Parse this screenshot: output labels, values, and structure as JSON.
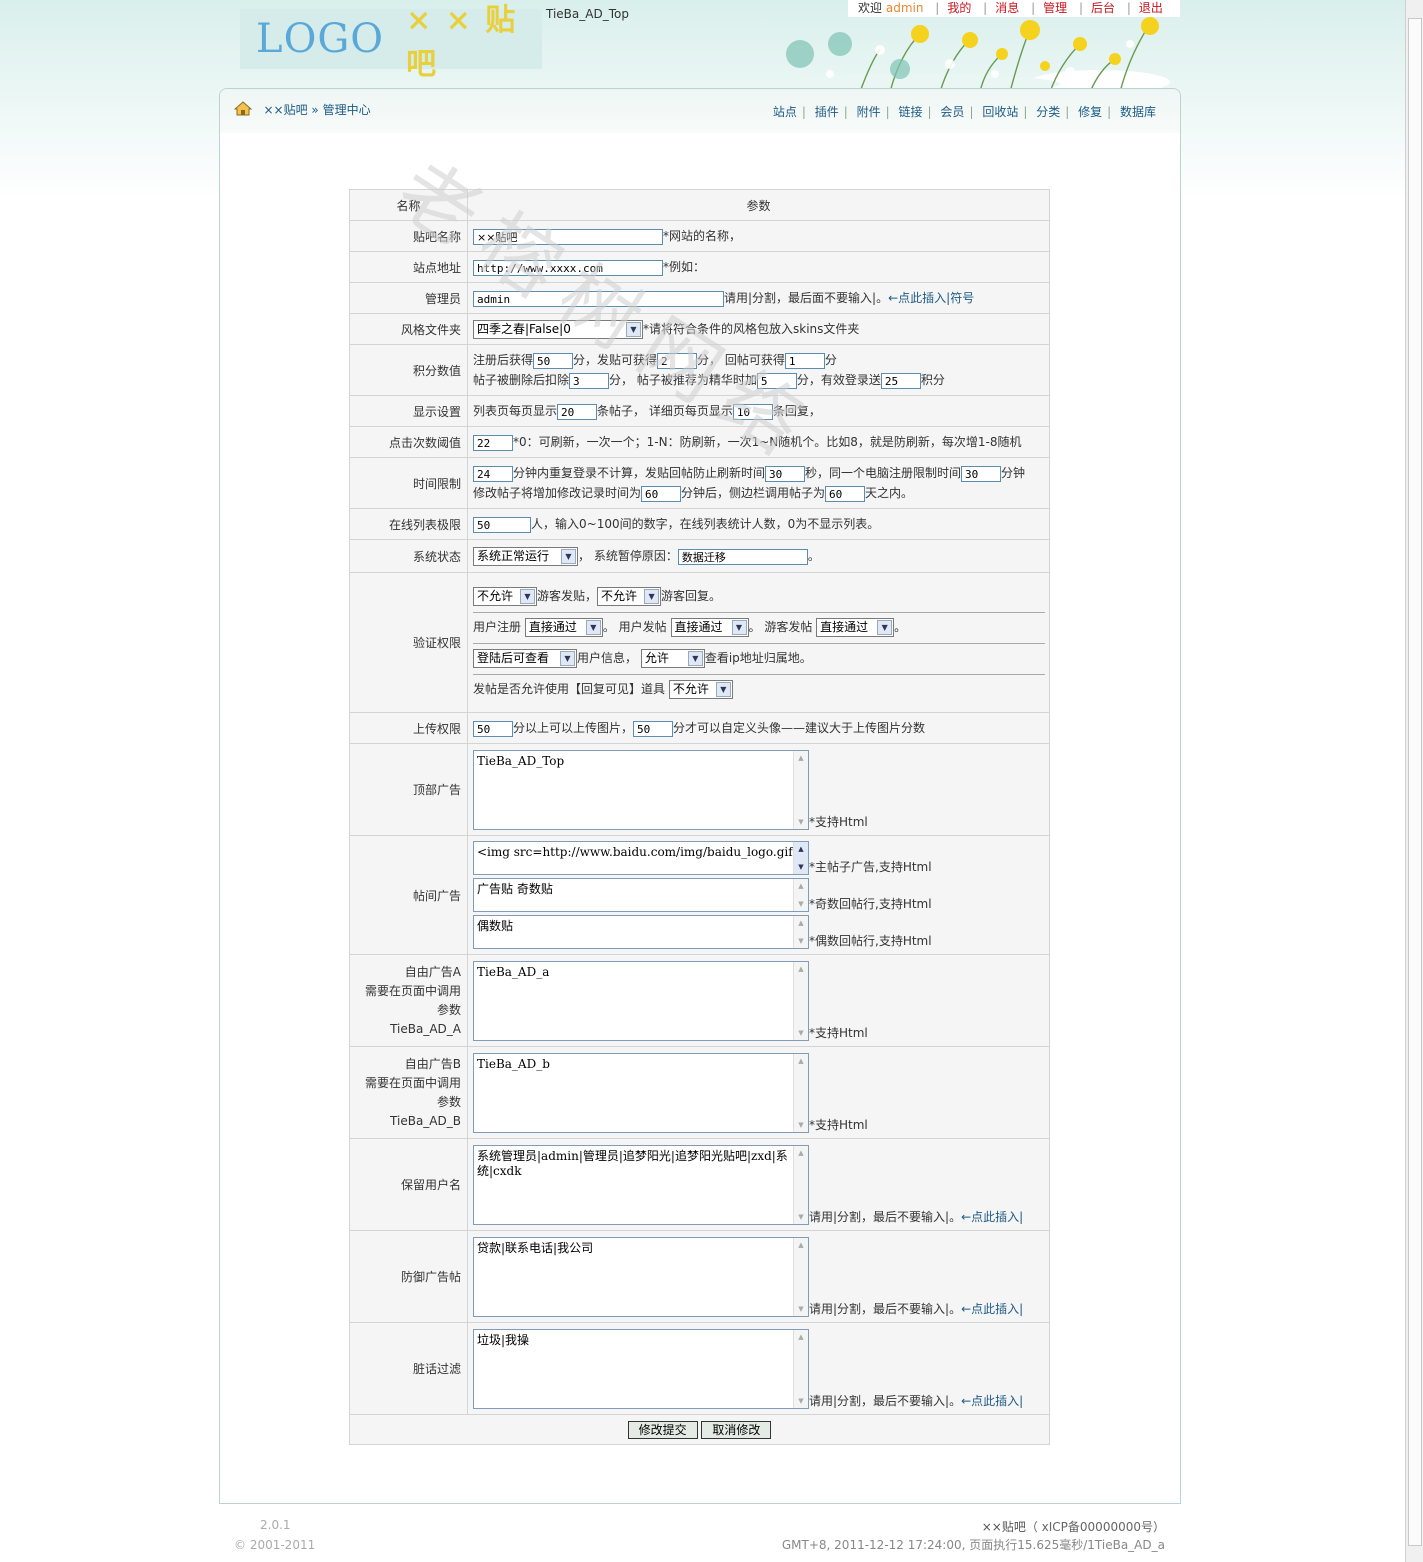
{
  "header": {
    "logo_text": "LOGO",
    "logo_sub": "× × 贴吧",
    "ad_top": "TieBa_AD_Top",
    "welcome": "欢迎",
    "username": "admin",
    "links": [
      "我的",
      "消息",
      "管理",
      "后台",
      "退出"
    ]
  },
  "nav": {
    "home": "××贴吧",
    "admin_center": "» 管理中心",
    "links": [
      "站点",
      "插件",
      "附件",
      "链接",
      "会员",
      "回收站",
      "分类",
      "修复",
      "数据库"
    ]
  },
  "watermark": "老榕树网络",
  "table": {
    "head_name": "名称",
    "head_param": "参数",
    "forum_name": {
      "label": "贴吧名称",
      "value": "××贴吧",
      "hint": "*网站的名称，"
    },
    "site_url": {
      "label": "站点地址",
      "value": "http://www.xxxx.com",
      "hint": "*例如："
    },
    "admin": {
      "label": "管理员",
      "value": "admin",
      "hint": "请用|分割，最后面不要输入|。",
      "insert": "←点此插入|符号"
    },
    "skin": {
      "label": "风格文件夹",
      "value": "四季之春|False|0",
      "hint": "*请将符合条件的风格包放入skins文件夹"
    },
    "points": {
      "label": "积分数值",
      "t1": "注册后获得",
      "v1": "50",
      "t2": "分，发贴可获得",
      "v2": "2",
      "t3": "分，  回帖可获得",
      "v3": "1",
      "t4": "分",
      "t5": "帖子被删除后扣除",
      "v5": "3",
      "t6": "分，  帖子被推荐为精华时加",
      "v6": "5",
      "t7": "分，有效登录送",
      "v7": "25",
      "t8": "积分"
    },
    "display": {
      "label": "显示设置",
      "t1": "列表页每页显示",
      "v1": "20",
      "t2": "条帖子，  详细页每页显示",
      "v2": "10",
      "t3": "条回复，"
    },
    "clicks": {
      "label": "点击次数阈值",
      "value": "22",
      "hint": "*0：可刷新，一次一个；1-N：防刷新，一次1~N随机个。比如8，就是防刷新，每次增1-8随机"
    },
    "time": {
      "label": "时间限制",
      "v1": "24",
      "t1": "分钟内重复登录不计算，发贴回帖防止刷新时间",
      "v2": "30",
      "t2": "秒，同一个电脑注册限制时间",
      "v3": "30",
      "t3": "分钟",
      "t4": "修改帖子将增加修改记录时间为",
      "v4": "60",
      "t5": "分钟后，侧边栏调用帖子为",
      "v5": "60",
      "t6": "天之内。"
    },
    "online": {
      "label": "在线列表极限",
      "value": "50",
      "hint": "人，输入0~100间的数字，在线列表统计人数，0为不显示列表。"
    },
    "status": {
      "label": "系统状态",
      "value": "系统正常运行",
      "t1": "，  系统暂停原因：",
      "reason": "数据迁移",
      "t2": "。"
    },
    "verify": {
      "label": "验证权限",
      "guest_post": "不允许",
      "t1": "游客发贴，",
      "guest_reply": "不允许",
      "t2": "游客回复。",
      "t3": "用户注册",
      "reg": "直接通过",
      "t4": "。  用户发帖",
      "user_post": "直接通过",
      "t5": "。  游客发帖",
      "guest_post2": "直接通过",
      "t6": "。",
      "user_info": "登陆后可查看",
      "t7": "用户信息，",
      "ip": "允许",
      "t8": "查看ip地址归属地。",
      "t9": "发帖是否允许使用【回复可见】道具",
      "reply_visible": "不允许"
    },
    "upload": {
      "label": "上传权限",
      "v1": "50",
      "t1": "分以上可以上传图片，",
      "v2": "50",
      "t2": "分才可以自定义头像——建议大于上传图片分数"
    },
    "top_ad": {
      "label": "顶部广告",
      "value": "TieBa_AD_Top",
      "hint": "*支持Html"
    },
    "post_ad": {
      "label": "帖间广告",
      "v1": " <img src=http://www.baidu.com/img/baidu_logo.gif",
      "h1": "*主帖子广告,支持Html",
      "v2": "广告贴 奇数贴",
      "h2": "*奇数回帖行,支持Html",
      "v3": "偶数贴",
      "h3": "*偶数回帖行,支持Html"
    },
    "free_a": {
      "l1": "自由广告A",
      "l2": "需要在页面中调用",
      "l3": "参数",
      "l4": "TieBa_AD_A",
      "value": "TieBa_AD_a",
      "hint": "*支持Html"
    },
    "free_b": {
      "l1": "自由广告B",
      "l2": "需要在页面中调用",
      "l3": "参数",
      "l4": "TieBa_AD_B",
      "value": "TieBa_AD_b",
      "hint": "*支持Html"
    },
    "reserved": {
      "label": "保留用户名",
      "value": "系统管理员|admin|管理员|追梦阳光|追梦阳光贴吧|zxd|系统|cxdk",
      "hint": "请用|分割，最后不要输入|。",
      "insert": "←点此插入|"
    },
    "antiad": {
      "label": "防御广告帖",
      "value": "贷款|联系电话|我公司",
      "hint": "请用|分割，最后不要输入|。",
      "insert": "←点此插入|"
    },
    "filter": {
      "label": "脏话过滤",
      "value": "垃圾|我操",
      "hint": "请用|分割，最后不要输入|。",
      "insert": "←点此插入|"
    },
    "submit": "修改提交",
    "cancel": "取消修改"
  },
  "footer": {
    "version": "2.0.1",
    "copyright": "© 2001-2011",
    "site": "××贴吧",
    "icp": "（ xICP备00000000号）",
    "time": "GMT+8, 2011-12-12 17:24:00, 页面执行15.625毫秒/1TieBa_AD_a"
  }
}
